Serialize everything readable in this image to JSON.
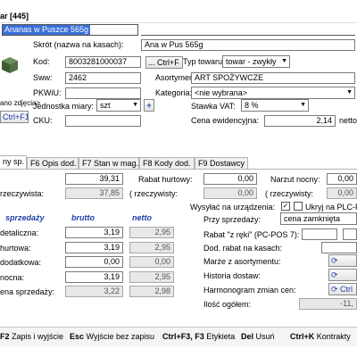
{
  "window": {
    "title": "ar [445]"
  },
  "search": {
    "value": "Ananas w Puszce 565g"
  },
  "product": {
    "skrot_label": "Skrót (nazwa na kasach):",
    "skrot_value": "Ana w Pus 565g",
    "kod_label": "Kod:",
    "kod_value": "8003281000037",
    "ctrlf_btn": "... Ctrl+F",
    "typ_label": "Typ towaru:",
    "typ_value": "towar - zwykły",
    "sww_label": "Sww:",
    "sww_value": "2462",
    "asort_label": "Asortyment:",
    "asort_value": "ART SPOŻYWCZE",
    "pkwiu_label": "PKWiU:",
    "kat_label": "Kategoria:",
    "kat_value": "<nie wybrana>",
    "jm_label": "Jednostka miary:",
    "jm_value": "szt",
    "vat_label": "Stawka VAT:",
    "vat_value": "8 %",
    "cku_label": "CKU:",
    "cena_ew_label": "Cena ewidencyjna:",
    "cena_ew_value": "2,14",
    "netto_label": "netto",
    "image_label": "ano zdjęcia>",
    "ctrlf11": "Ctrl+F11"
  },
  "tabs": [
    {
      "label": "ny sp."
    },
    {
      "label": "F6  Opis dod."
    },
    {
      "label": "F7  Stan w mag."
    },
    {
      "label": "F8  Kody dod."
    },
    {
      "label": "F9  Dostawcy"
    }
  ],
  "pricing": {
    "cena_zak_value": "39,31",
    "rzecz_label": "rzeczywista:",
    "rzecz_value": "37,85",
    "rabat_hurt_label": "Rabat hurtowy:",
    "rabat_hurt_value": "0,00",
    "rzecz_hurt_label": "( rzeczywisty:",
    "rzecz_hurt_value": "0,00",
    "narzut_label": "Narzut nocny:",
    "narzut_value": "0,00",
    "rzecz_narz_label": "( rzeczywisty:",
    "rzecz_narz_value": "0,00",
    "hdr_sprzedazy": "sprzedaży",
    "hdr_brutto": "brutto",
    "hdr_netto": "netto",
    "rows": [
      {
        "label": "detaliczna:",
        "brutto": "3,19",
        "netto": "2,95"
      },
      {
        "label": "hurtowa:",
        "brutto": "3,19",
        "netto": "2,95"
      },
      {
        "label": "dodatkowa:",
        "brutto": "0,00",
        "netto": "0,00"
      },
      {
        "label": "nocna:",
        "brutto": "3,19",
        "netto": "2,95"
      },
      {
        "label": "ena sprzedaży:",
        "brutto": "3,22",
        "netto": "2,98"
      }
    ]
  },
  "right": {
    "wysylac_label": "Wysyłać na urządzenia:",
    "ukryj_label": "Ukryj na PLC-POS",
    "przy_sprz_label": "Przy sprzedaży:",
    "przy_sprz_value": "cena zamknięta",
    "rabat_reki_label": "Rabat \"z ręki\" (PC-POS 7):",
    "dod_rabat_label": "Dod. rabat na kasach:",
    "marze_label": "Marże z asortymentu:",
    "historia_label": "Historia dostaw:",
    "harmonogram_label": "Harmonogram zmian cen:",
    "ilosc_label": "Ilość ogółem:",
    "ilosc_value": "-11,"
  },
  "footer": [
    {
      "key": "F2",
      "text": "Zapis i wyjście"
    },
    {
      "key": "Esc",
      "text": "Wyjście bez zapisu"
    },
    {
      "key": "Ctrl+F3, F3",
      "text": "Etykieta"
    },
    {
      "key": "Del",
      "text": "Usuń"
    },
    {
      "key": "Ctrl+K",
      "text": "Kontrakty"
    }
  ],
  "colors": {
    "title_blue": "#1f3fa8",
    "search_bg": "#3a6fd8"
  }
}
